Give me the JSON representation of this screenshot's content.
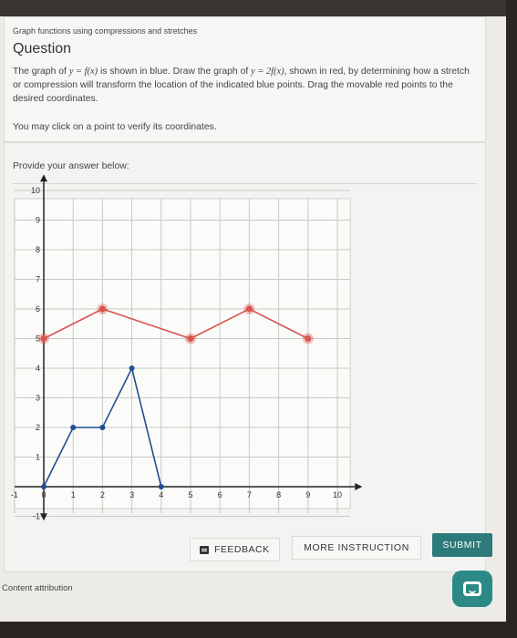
{
  "header": {
    "breadcrumb": "Graph functions using compressions and stretches",
    "title": "Question"
  },
  "question": {
    "text_before": "The graph of ",
    "f_expr": "y = f(x)",
    "text_mid": " is shown in blue. Draw the graph of ",
    "g_expr": "y = 2f(x)",
    "text_after": ", shown in red, by determining how a stretch or compression will transform the location of the indicated blue points. Drag the movable red points to the desired coordinates.",
    "hint": "You may click on a point to verify its coordinates."
  },
  "answer": {
    "label": "Provide your answer below:"
  },
  "chart_data": {
    "type": "line",
    "xlim": [
      -1,
      10
    ],
    "ylim": [
      -1,
      10
    ],
    "x_ticks": [
      "-1",
      "0",
      "1",
      "2",
      "3",
      "4",
      "5",
      "6",
      "7",
      "8",
      "9",
      "10"
    ],
    "y_ticks": [
      "10",
      "9",
      "8",
      "7",
      "6",
      "5",
      "4",
      "3",
      "2",
      "1",
      "-1"
    ],
    "grid": true,
    "series": [
      {
        "color": "#1f4f94",
        "points": [
          [
            0,
            0
          ],
          [
            1,
            2
          ],
          [
            2,
            2
          ],
          [
            3,
            4
          ],
          [
            4,
            0
          ]
        ]
      },
      {
        "color": "#d9534f",
        "points": [
          [
            0,
            5
          ],
          [
            2,
            6
          ],
          [
            5,
            5
          ],
          [
            7,
            6
          ],
          [
            9,
            5
          ]
        ]
      }
    ]
  },
  "actions": {
    "feedback_label": "FEEDBACK",
    "more_label": "MORE INSTRUCTION",
    "submit_label": "SUBMIT"
  },
  "footer": {
    "attribution": "Content attribution"
  },
  "icons": {
    "feedback": "feedback-icon",
    "chat": "chat-icon"
  },
  "colors": {
    "accent": "#2c7a79",
    "blue_series": "#1f4f94",
    "red_series": "#d9534f"
  }
}
